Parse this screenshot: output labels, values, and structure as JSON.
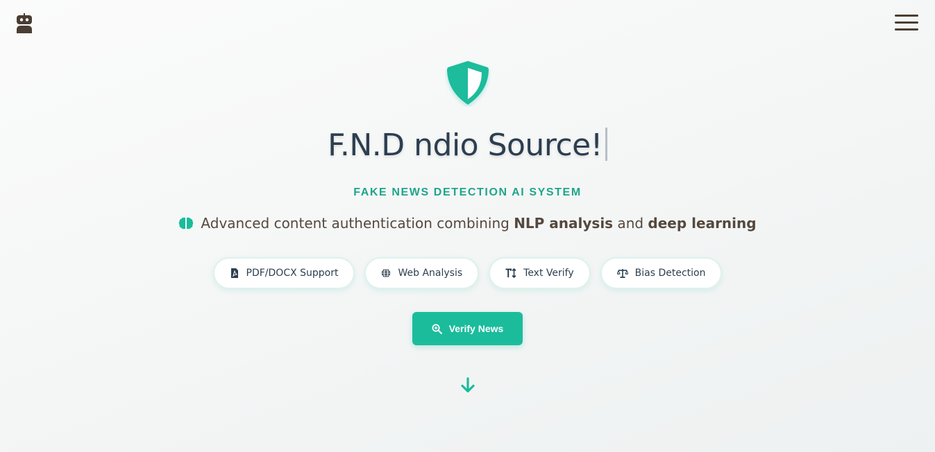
{
  "header": {
    "logo_icon": "robot-icon",
    "menu_icon": "hamburger-menu-icon"
  },
  "hero": {
    "icon": "shield-icon",
    "title": "F.N.D ndio Source!",
    "subtitle": "FAKE NEWS DETECTION AI SYSTEM",
    "tagline": {
      "icon": "brain-icon",
      "prefix": "Advanced content authentication combining ",
      "highlight1": "NLP analysis",
      "middle": " and ",
      "highlight2": "deep learning"
    }
  },
  "features": [
    {
      "label": "PDF/DOCX Support",
      "icon": "file-pdf-icon"
    },
    {
      "label": "Web Analysis",
      "icon": "globe-icon"
    },
    {
      "label": "Text Verify",
      "icon": "text-height-icon"
    },
    {
      "label": "Bias Detection",
      "icon": "balance-scale-icon"
    }
  ],
  "cta": {
    "label": "Verify News",
    "icon": "search-plus-icon"
  },
  "scroll_icon": "arrow-down-icon",
  "colors": {
    "accent": "#1abc9c",
    "title": "#2c3e50",
    "subtitle": "#1ea58a",
    "text": "#55483e",
    "dark_icon": "#4a3d33"
  }
}
